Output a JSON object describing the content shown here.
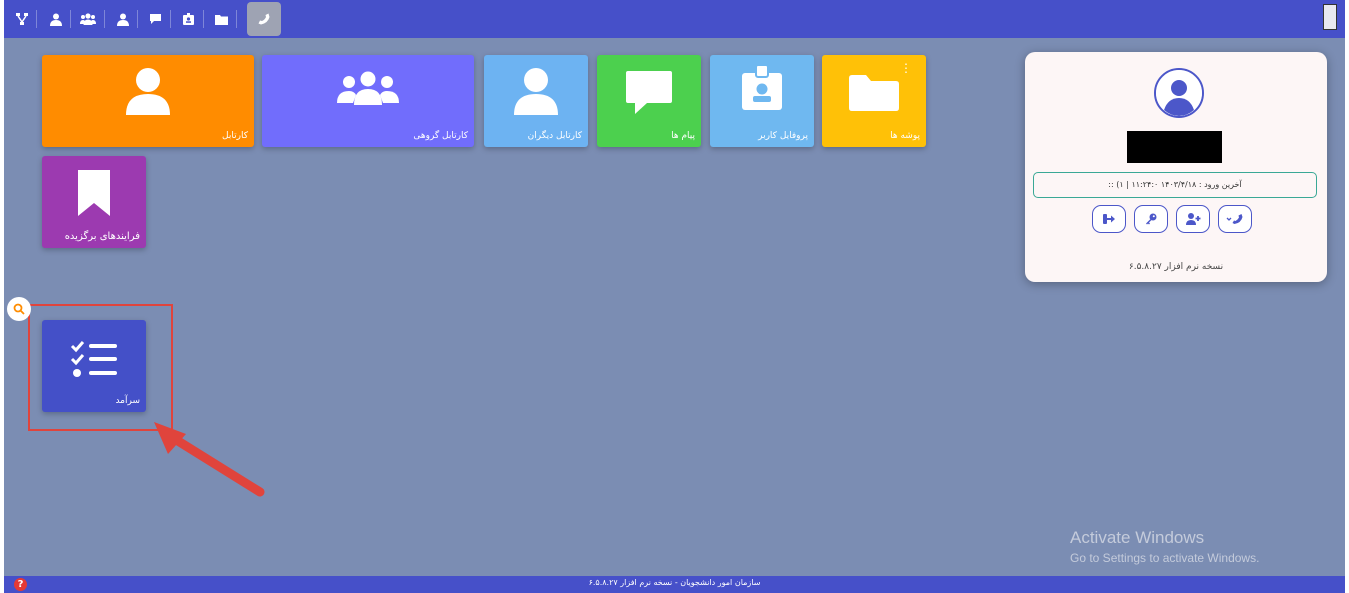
{
  "toolbar": {
    "buttons": [
      {
        "icon": "sitemap-icon"
      },
      {
        "icon": "user-icon"
      },
      {
        "icon": "users-icon"
      },
      {
        "icon": "user-icon"
      },
      {
        "icon": "comment-icon"
      },
      {
        "icon": "id-badge-icon"
      },
      {
        "icon": "folder-icon"
      },
      {
        "icon": "phone-icon",
        "active": true
      }
    ]
  },
  "tiles": [
    {
      "label": "کارتابل",
      "color": "#ff8c00",
      "icon": "user-icon"
    },
    {
      "label": "کارتابل گروهی",
      "color": "#716dfc",
      "icon": "users-icon"
    },
    {
      "label": "کارتابل دیگران",
      "color": "#6db3f2",
      "icon": "user-icon"
    },
    {
      "label": "پیام ها",
      "color": "#4cd04e",
      "icon": "comment-icon"
    },
    {
      "label": "پروفایل کاربر",
      "color": "#6fb8f0",
      "icon": "id-badge-icon"
    },
    {
      "label": "پوشه ها",
      "color": "#ffc107",
      "icon": "folder-icon",
      "menu": "⋮"
    },
    {
      "label": "فرایندهای برگزیده",
      "color": "#9c3ab0",
      "icon": "bookmark-icon"
    },
    {
      "label": "سرآمد",
      "color": "#4450c8",
      "icon": "tasks-icon"
    }
  ],
  "profile": {
    "last_login": "آخرین ورود : ۱۴۰۳/۴/۱۸ ۱۱:۲۴:۰ | ۱) ::",
    "version": "نسخه نرم افزار ۶.۵.۸.۲۷",
    "actions": [
      {
        "icon": "sign-out-icon"
      },
      {
        "icon": "key-icon"
      },
      {
        "icon": "user-plus-icon"
      },
      {
        "icon": "phone-dropdown-icon"
      }
    ]
  },
  "watermark": {
    "line1": "Activate Windows",
    "line2": "Go to Settings to activate Windows."
  },
  "footer": {
    "text": "سازمان امور دانشجویان - نسخه نرم افزار ۶.۵.۸.۲۷",
    "help": "?"
  },
  "colors": {
    "primary": "#4650c9",
    "background": "#7b8db3",
    "highlight": "#e0443c"
  }
}
